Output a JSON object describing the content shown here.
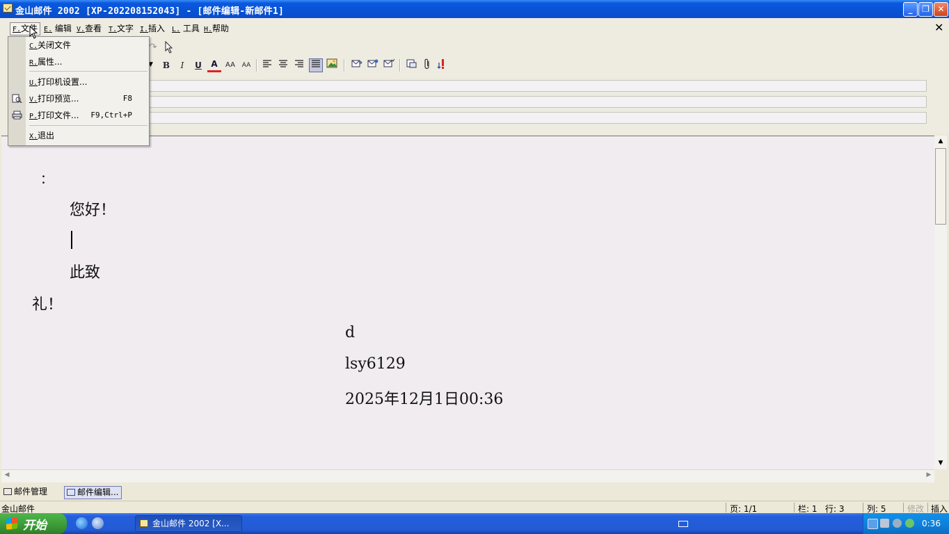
{
  "window": {
    "title": "金山邮件 2002 [XP-202208152043] - [邮件编辑-新邮件1]"
  },
  "menubar": {
    "items": [
      {
        "key": "F.",
        "label": "文件"
      },
      {
        "key": "E.",
        "label": "编辑"
      },
      {
        "key": "V.",
        "label": "查看"
      },
      {
        "key": "T.",
        "label": "文字"
      },
      {
        "key": "I.",
        "label": "插入"
      },
      {
        "key": "L.",
        "label": "工具"
      },
      {
        "key": "H.",
        "label": "帮助"
      }
    ],
    "close_glyph": "✕"
  },
  "file_menu": {
    "items": [
      {
        "key": "C.",
        "label": "关闭文件",
        "shortcut": ""
      },
      {
        "key": "R.",
        "label": "属性...",
        "shortcut": ""
      },
      {
        "key": "U.",
        "label": "打印机设置...",
        "shortcut": ""
      },
      {
        "key": "V.",
        "label": "打印预览...",
        "shortcut": "F8",
        "icon": "print-preview-icon"
      },
      {
        "key": "P.",
        "label": "打印文件...",
        "shortcut": "F9,Ctrl+P",
        "icon": "printer-icon"
      },
      {
        "key": "X.",
        "label": "退出",
        "shortcut": ""
      }
    ]
  },
  "toolbar": {
    "format_buttons": [
      "B",
      "I",
      "U",
      "A",
      "AA",
      "AA"
    ],
    "align_buttons": [
      "align-left-icon",
      "align-center-icon",
      "align-right-icon",
      "justify-icon"
    ],
    "justify_active": true
  },
  "editor": {
    "lines": {
      "colon": "：",
      "greeting": "您好！",
      "closing": "此致",
      "salute": "礼！",
      "sign_name": "d",
      "sign_user": "lsy6129",
      "sign_date": "2025年12月1日00:36"
    }
  },
  "doc_tabs": [
    {
      "label": "邮件管理",
      "active": false
    },
    {
      "label": "邮件编辑...",
      "active": true
    }
  ],
  "statusbar": {
    "left": "金山邮件",
    "page": "页: 1/1",
    "column_box": "栏: 1",
    "row": "行: 3",
    "col": "列: 5",
    "modify": "修改",
    "insert": "插入"
  },
  "taskbar": {
    "start_label": "开始",
    "task_item": "金山邮件 2002 [X...",
    "clock": "0:36"
  }
}
